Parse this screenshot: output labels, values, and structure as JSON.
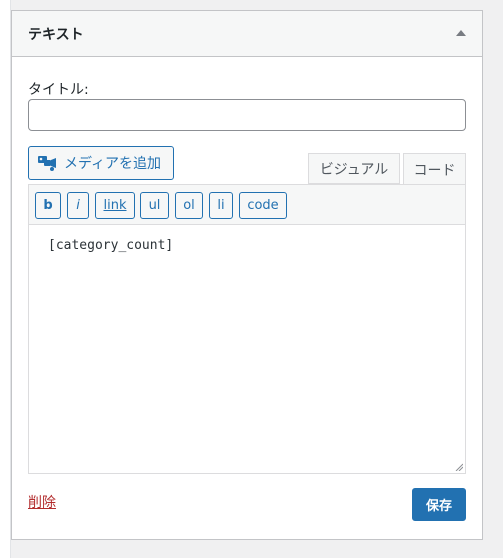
{
  "widget": {
    "title": "テキスト",
    "toggle_icon": "triangle-up-icon"
  },
  "form": {
    "title_label": "タイトル:",
    "title_value": "",
    "title_placeholder": ""
  },
  "editor": {
    "add_media_label": "メディアを追加",
    "add_media_icon": "add-media-icon",
    "tabs": {
      "visual": "ビジュアル",
      "code": "コード"
    },
    "active_tab": "code",
    "quicktags": [
      "b",
      "i",
      "link",
      "ul",
      "ol",
      "li",
      "code"
    ],
    "content": "[category_count]"
  },
  "actions": {
    "delete_label": "削除",
    "save_label": "保存"
  },
  "colors": {
    "accent": "#2271b1",
    "delete": "#b32d2e"
  }
}
